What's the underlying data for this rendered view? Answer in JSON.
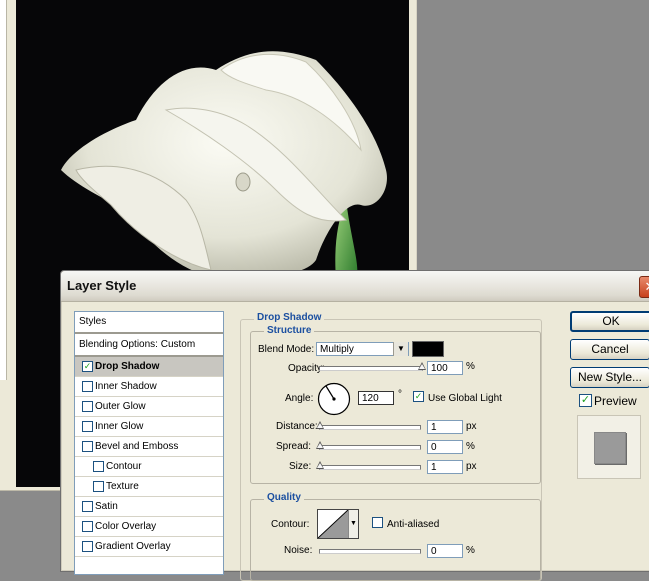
{
  "dialog": {
    "title": "Layer Style",
    "close_glyph": "✕"
  },
  "styles_list": {
    "header": "Styles",
    "blending": "Blending Options: Custom",
    "items": [
      {
        "label": "Drop Shadow",
        "checked": true,
        "selected": true,
        "indent": false
      },
      {
        "label": "Inner Shadow",
        "checked": false,
        "selected": false,
        "indent": false
      },
      {
        "label": "Outer Glow",
        "checked": false,
        "selected": false,
        "indent": false
      },
      {
        "label": "Inner Glow",
        "checked": false,
        "selected": false,
        "indent": false
      },
      {
        "label": "Bevel and Emboss",
        "checked": false,
        "selected": false,
        "indent": false
      },
      {
        "label": "Contour",
        "checked": false,
        "selected": false,
        "indent": true
      },
      {
        "label": "Texture",
        "checked": false,
        "selected": false,
        "indent": true
      },
      {
        "label": "Satin",
        "checked": false,
        "selected": false,
        "indent": false
      },
      {
        "label": "Color Overlay",
        "checked": false,
        "selected": false,
        "indent": false
      },
      {
        "label": "Gradient Overlay",
        "checked": false,
        "selected": false,
        "indent": false
      }
    ]
  },
  "drop_shadow": {
    "section_title": "Drop Shadow",
    "structure_title": "Structure",
    "blend_mode_label": "Blend Mode:",
    "blend_mode_value": "Multiply",
    "shadow_color": "#000000",
    "opacity_label": "Opacity:",
    "opacity_value": "100",
    "opacity_unit": "%",
    "opacity_fraction": 1.0,
    "angle_label": "Angle:",
    "angle_value": "120",
    "angle_unit": "°",
    "use_global_light_label": "Use Global Light",
    "use_global_light": true,
    "distance_label": "Distance:",
    "distance_value": "1",
    "distance_unit": "px",
    "spread_label": "Spread:",
    "spread_value": "0",
    "spread_unit": "%",
    "size_label": "Size:",
    "size_value": "1",
    "size_unit": "px",
    "quality_title": "Quality",
    "contour_label": "Contour:",
    "anti_aliased_label": "Anti-aliased",
    "anti_aliased": false,
    "noise_label": "Noise:",
    "noise_value": "0",
    "noise_unit": "%"
  },
  "buttons": {
    "ok": "OK",
    "cancel": "Cancel",
    "new_style": "New Style...",
    "preview_label": "Preview",
    "preview_checked": true
  },
  "colors": {
    "accent_blue": "#1b4fa0",
    "check_green": "#21a121",
    "canvas_bg": "#060608"
  }
}
